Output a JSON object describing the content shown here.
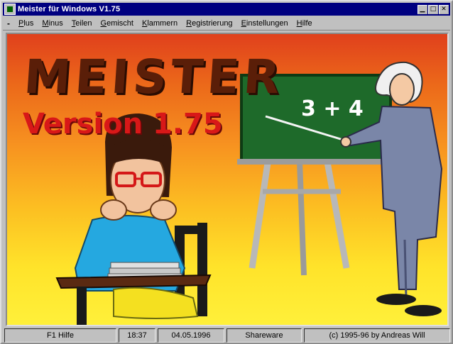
{
  "window": {
    "title": "Meister für Windows V1.75"
  },
  "menu": {
    "system_glyph": "-",
    "items": [
      {
        "key": "P",
        "rest": "lus"
      },
      {
        "key": "M",
        "rest": "inus"
      },
      {
        "key": "T",
        "rest": "eilen"
      },
      {
        "key": "G",
        "rest": "emischt"
      },
      {
        "key": "K",
        "rest": "lammern"
      },
      {
        "key": "R",
        "rest": "egistrierung"
      },
      {
        "key": "E",
        "rest": "instellungen"
      },
      {
        "key": "H",
        "rest": "ilfe"
      }
    ]
  },
  "splash": {
    "title": "MEISTER",
    "version": "Version 1.75",
    "board_expression": "3 + 4"
  },
  "status": {
    "help": "F1 Hilfe",
    "time": "18:37",
    "date": "04.05.1996",
    "license": "Shareware",
    "copyright": "(c) 1995-96 by Andreas Will"
  },
  "colors": {
    "titlebar": "#000080",
    "chalkboard": "#1e6a2a",
    "title_text": "#5a1e08",
    "version_text": "#d81818"
  },
  "icons": {
    "app": "meister-app-icon",
    "minimize": "minimize-icon",
    "maximize": "maximize-icon",
    "close": "close-icon"
  }
}
